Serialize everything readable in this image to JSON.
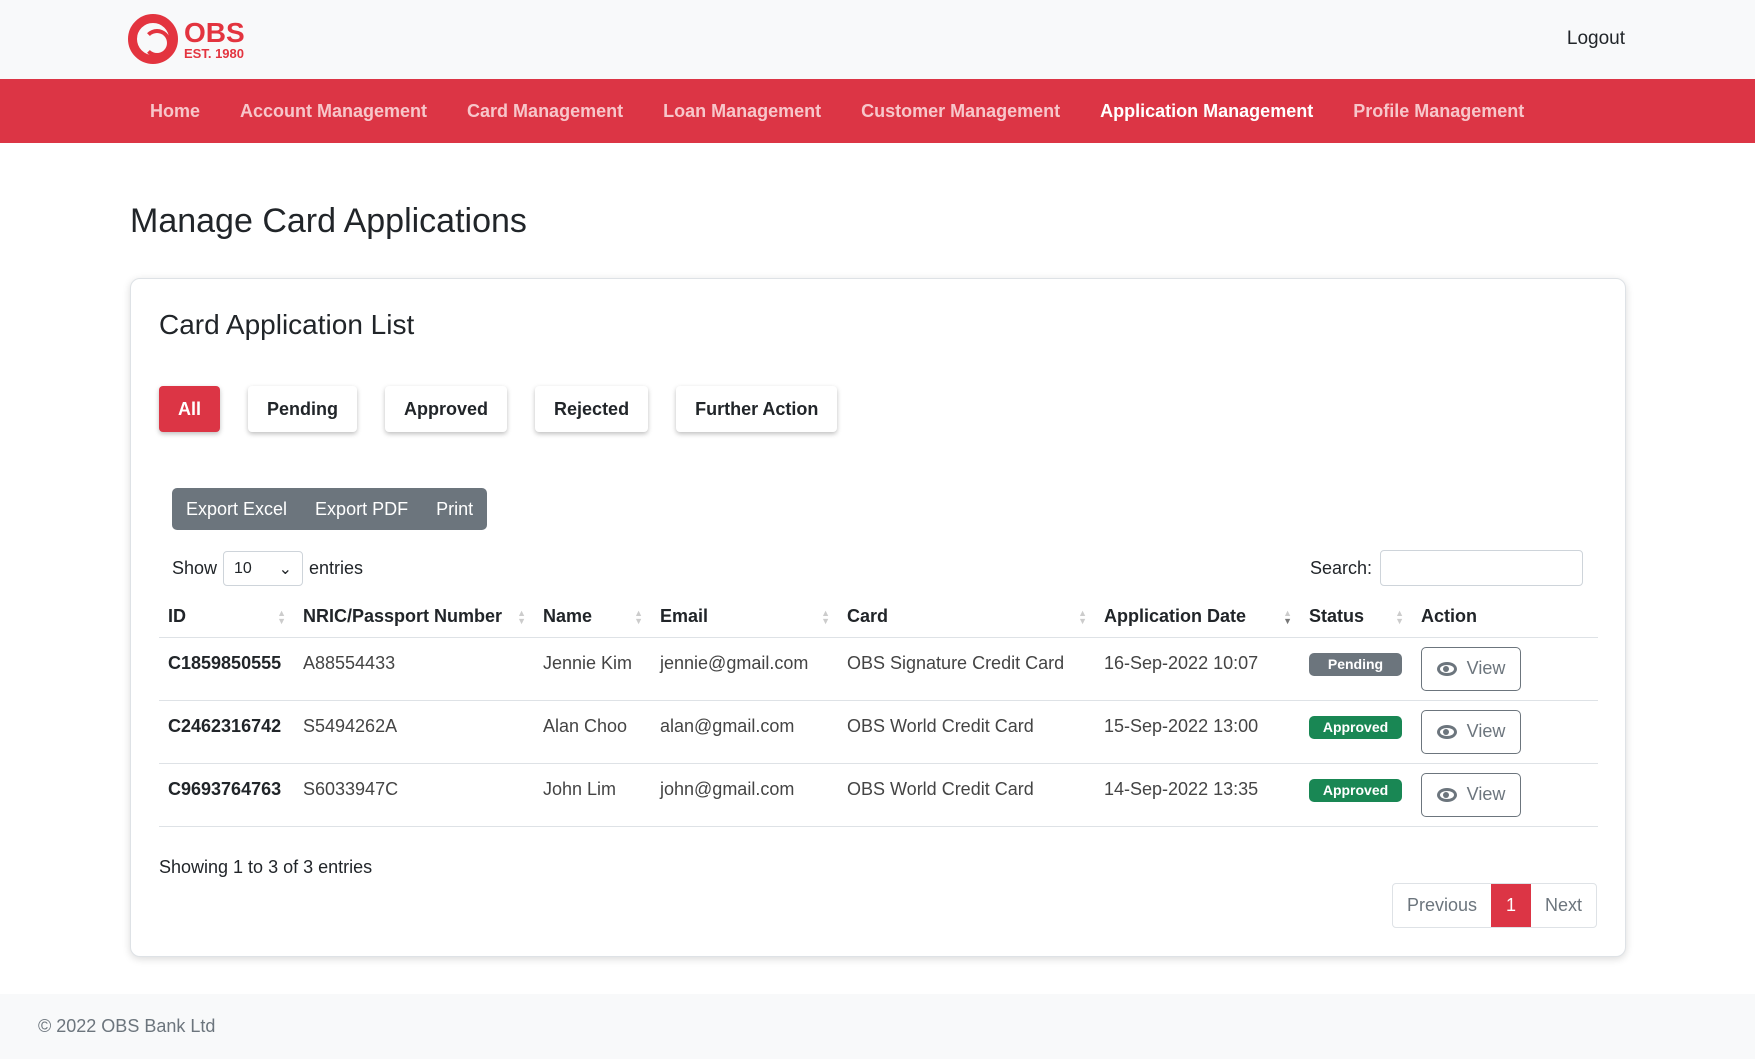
{
  "header": {
    "logo_name": "OBS",
    "logo_est": "EST. 1980",
    "logout": "Logout"
  },
  "nav": [
    "Home",
    "Account Management",
    "Card Management",
    "Loan Management",
    "Customer Management",
    "Application Management",
    "Profile Management"
  ],
  "page_title": "Manage Card Applications",
  "card_title": "Card Application List",
  "filters": [
    "All",
    "Pending",
    "Approved",
    "Rejected",
    "Further Action"
  ],
  "export": [
    "Export Excel",
    "Export PDF",
    "Print"
  ],
  "show": {
    "label": "Show",
    "value": "10",
    "suffix": "entries"
  },
  "search": {
    "label": "Search:",
    "value": ""
  },
  "columns": [
    "ID",
    "NRIC/Passport Number",
    "Name",
    "Email",
    "Card",
    "Application Date",
    "Status",
    "Action"
  ],
  "rows": [
    {
      "id": "C1859850555",
      "nric": "A88554433",
      "name": "Jennie Kim",
      "email": "jennie@gmail.com",
      "card": "OBS Signature Credit Card",
      "date": "16-Sep-2022 10:07",
      "status": "Pending",
      "action": "View"
    },
    {
      "id": "C2462316742",
      "nric": "S5494262A",
      "name": "Alan Choo",
      "email": "alan@gmail.com",
      "card": "OBS World Credit Card",
      "date": "15-Sep-2022 13:00",
      "status": "Approved",
      "action": "View"
    },
    {
      "id": "C9693764763",
      "nric": "S6033947C",
      "name": "John Lim",
      "email": "john@gmail.com",
      "card": "OBS World Credit Card",
      "date": "14-Sep-2022 13:35",
      "status": "Approved",
      "action": "View"
    }
  ],
  "info": "Showing 1 to 3 of 3 entries",
  "pagination": {
    "previous": "Previous",
    "current": "1",
    "next": "Next"
  },
  "footer": "© 2022 OBS Bank Ltd",
  "colors": {
    "brand": "#dc3545",
    "pending": "#6c757d",
    "approved": "#198754"
  }
}
